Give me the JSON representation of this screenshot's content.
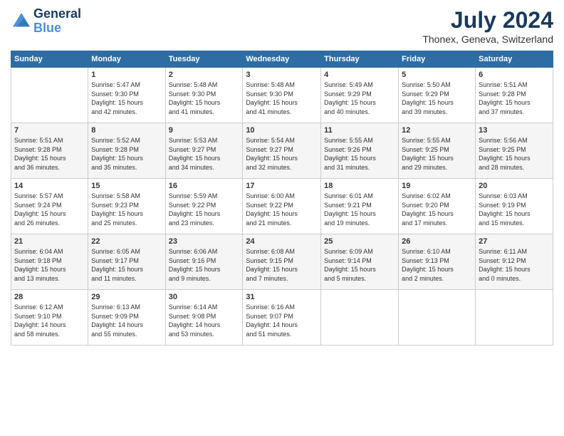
{
  "header": {
    "logo_line1": "General",
    "logo_line2": "Blue",
    "month_year": "July 2024",
    "location": "Thonex, Geneva, Switzerland"
  },
  "days_of_week": [
    "Sunday",
    "Monday",
    "Tuesday",
    "Wednesday",
    "Thursday",
    "Friday",
    "Saturday"
  ],
  "weeks": [
    [
      {
        "day": "",
        "info": ""
      },
      {
        "day": "1",
        "info": "Sunrise: 5:47 AM\nSunset: 9:30 PM\nDaylight: 15 hours\nand 42 minutes."
      },
      {
        "day": "2",
        "info": "Sunrise: 5:48 AM\nSunset: 9:30 PM\nDaylight: 15 hours\nand 41 minutes."
      },
      {
        "day": "3",
        "info": "Sunrise: 5:48 AM\nSunset: 9:30 PM\nDaylight: 15 hours\nand 41 minutes."
      },
      {
        "day": "4",
        "info": "Sunrise: 5:49 AM\nSunset: 9:29 PM\nDaylight: 15 hours\nand 40 minutes."
      },
      {
        "day": "5",
        "info": "Sunrise: 5:50 AM\nSunset: 9:29 PM\nDaylight: 15 hours\nand 39 minutes."
      },
      {
        "day": "6",
        "info": "Sunrise: 5:51 AM\nSunset: 9:28 PM\nDaylight: 15 hours\nand 37 minutes."
      }
    ],
    [
      {
        "day": "7",
        "info": "Sunrise: 5:51 AM\nSunset: 9:28 PM\nDaylight: 15 hours\nand 36 minutes."
      },
      {
        "day": "8",
        "info": "Sunrise: 5:52 AM\nSunset: 9:28 PM\nDaylight: 15 hours\nand 35 minutes."
      },
      {
        "day": "9",
        "info": "Sunrise: 5:53 AM\nSunset: 9:27 PM\nDaylight: 15 hours\nand 34 minutes."
      },
      {
        "day": "10",
        "info": "Sunrise: 5:54 AM\nSunset: 9:27 PM\nDaylight: 15 hours\nand 32 minutes."
      },
      {
        "day": "11",
        "info": "Sunrise: 5:55 AM\nSunset: 9:26 PM\nDaylight: 15 hours\nand 31 minutes."
      },
      {
        "day": "12",
        "info": "Sunrise: 5:55 AM\nSunset: 9:25 PM\nDaylight: 15 hours\nand 29 minutes."
      },
      {
        "day": "13",
        "info": "Sunrise: 5:56 AM\nSunset: 9:25 PM\nDaylight: 15 hours\nand 28 minutes."
      }
    ],
    [
      {
        "day": "14",
        "info": "Sunrise: 5:57 AM\nSunset: 9:24 PM\nDaylight: 15 hours\nand 26 minutes."
      },
      {
        "day": "15",
        "info": "Sunrise: 5:58 AM\nSunset: 9:23 PM\nDaylight: 15 hours\nand 25 minutes."
      },
      {
        "day": "16",
        "info": "Sunrise: 5:59 AM\nSunset: 9:22 PM\nDaylight: 15 hours\nand 23 minutes."
      },
      {
        "day": "17",
        "info": "Sunrise: 6:00 AM\nSunset: 9:22 PM\nDaylight: 15 hours\nand 21 minutes."
      },
      {
        "day": "18",
        "info": "Sunrise: 6:01 AM\nSunset: 9:21 PM\nDaylight: 15 hours\nand 19 minutes."
      },
      {
        "day": "19",
        "info": "Sunrise: 6:02 AM\nSunset: 9:20 PM\nDaylight: 15 hours\nand 17 minutes."
      },
      {
        "day": "20",
        "info": "Sunrise: 6:03 AM\nSunset: 9:19 PM\nDaylight: 15 hours\nand 15 minutes."
      }
    ],
    [
      {
        "day": "21",
        "info": "Sunrise: 6:04 AM\nSunset: 9:18 PM\nDaylight: 15 hours\nand 13 minutes."
      },
      {
        "day": "22",
        "info": "Sunrise: 6:05 AM\nSunset: 9:17 PM\nDaylight: 15 hours\nand 11 minutes."
      },
      {
        "day": "23",
        "info": "Sunrise: 6:06 AM\nSunset: 9:16 PM\nDaylight: 15 hours\nand 9 minutes."
      },
      {
        "day": "24",
        "info": "Sunrise: 6:08 AM\nSunset: 9:15 PM\nDaylight: 15 hours\nand 7 minutes."
      },
      {
        "day": "25",
        "info": "Sunrise: 6:09 AM\nSunset: 9:14 PM\nDaylight: 15 hours\nand 5 minutes."
      },
      {
        "day": "26",
        "info": "Sunrise: 6:10 AM\nSunset: 9:13 PM\nDaylight: 15 hours\nand 2 minutes."
      },
      {
        "day": "27",
        "info": "Sunrise: 6:11 AM\nSunset: 9:12 PM\nDaylight: 15 hours\nand 0 minutes."
      }
    ],
    [
      {
        "day": "28",
        "info": "Sunrise: 6:12 AM\nSunset: 9:10 PM\nDaylight: 14 hours\nand 58 minutes."
      },
      {
        "day": "29",
        "info": "Sunrise: 6:13 AM\nSunset: 9:09 PM\nDaylight: 14 hours\nand 55 minutes."
      },
      {
        "day": "30",
        "info": "Sunrise: 6:14 AM\nSunset: 9:08 PM\nDaylight: 14 hours\nand 53 minutes."
      },
      {
        "day": "31",
        "info": "Sunrise: 6:16 AM\nSunset: 9:07 PM\nDaylight: 14 hours\nand 51 minutes."
      },
      {
        "day": "",
        "info": ""
      },
      {
        "day": "",
        "info": ""
      },
      {
        "day": "",
        "info": ""
      }
    ]
  ]
}
